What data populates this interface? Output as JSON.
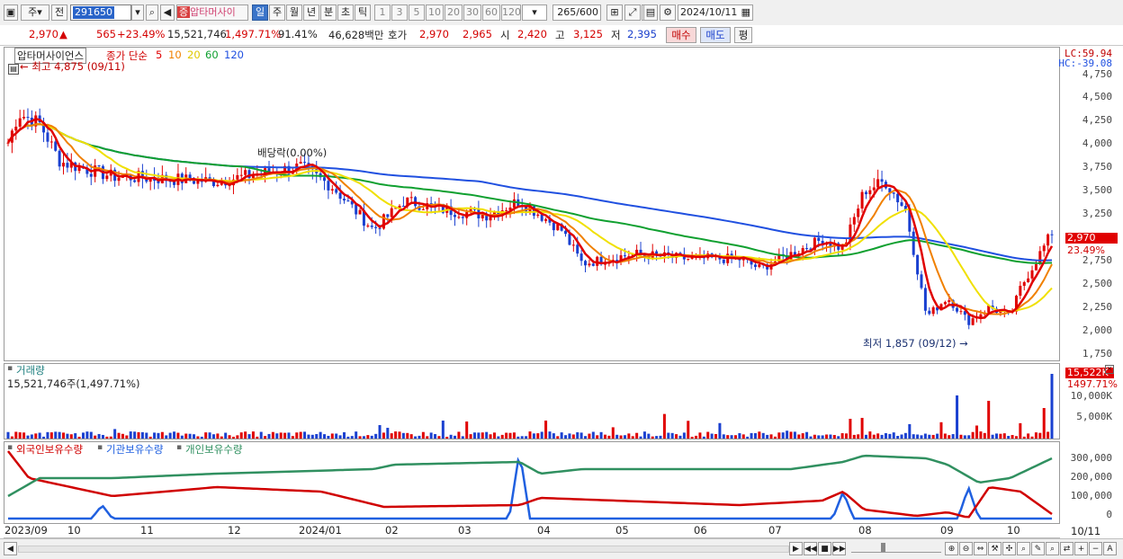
{
  "toolbar": {
    "period_unit": "주",
    "prev_label": "전",
    "stock_code": "291650",
    "stock_name": "압타머사이",
    "name_badge": "증",
    "periods": [
      "일",
      "주",
      "월",
      "년",
      "분",
      "초",
      "틱"
    ],
    "selected_period": "일",
    "intervals": [
      "1",
      "3",
      "5",
      "10",
      "20",
      "30",
      "60",
      "120"
    ],
    "count": "265",
    "count_max": "/600",
    "date": "2024/10/11"
  },
  "quote": {
    "price": "2,970",
    "change_arrow": "▲",
    "change": "565",
    "change_pct": "+23.49%",
    "volume": "15,521,746",
    "volume_ratio": "1,497.71%",
    "turnover": "91.41%",
    "amount": "46,628백만",
    "bid_label": "호가",
    "ask_price": "2,970",
    "bid_price": "2,965",
    "open_label": "시",
    "open": "2,420",
    "high_label": "고",
    "high": "3,125",
    "low_label": "저",
    "low": "2,395",
    "buy_label": "매수",
    "sell_label": "매도",
    "avg_label": "평"
  },
  "price_panel": {
    "stock_label": "압타머사이언스",
    "ma_label": "종가 단순",
    "ma_periods": [
      "5",
      "10",
      "20",
      "60",
      "120"
    ],
    "ma_colors": [
      "#e00000",
      "#f08000",
      "#f0e000",
      "#10a030",
      "#2050e0"
    ],
    "high_note": "최고 4,875 (09/11)",
    "dividend_note": "배당락(0.00%)",
    "low_note": "최저 1,857 (09/12)",
    "lc": "LC:59.94",
    "hc": "HC:-39.08",
    "last_price": "2,970",
    "last_pct": "23.49%",
    "ticks": [
      "4,750",
      "4,500",
      "4,250",
      "4,000",
      "3,750",
      "3,500",
      "3,250",
      "2,750",
      "2,500",
      "2,250",
      "2,000",
      "1,750"
    ],
    "up_color": "#e00000",
    "down_color": "#1a40d0"
  },
  "volume_panel": {
    "title": "거래량",
    "value": "15,521,746주(1,497.71%)",
    "last_value": "15,522K",
    "last_pct": "1497.71%",
    "ticks": [
      "10,000K",
      "5,000K"
    ]
  },
  "holding_panel": {
    "foreign": "외국인보유수량",
    "institution": "기관보유수량",
    "individual": "개인보유수량",
    "colors": [
      "#d00000",
      "#2060e0",
      "#309060"
    ],
    "ticks": [
      "300,000",
      "200,000",
      "100,000",
      "0"
    ]
  },
  "x_axis": {
    "labels": [
      "2023/09",
      "10",
      "11",
      "12",
      "2024/01",
      "02",
      "03",
      "04",
      "05",
      "06",
      "07",
      "08",
      "09",
      "10"
    ],
    "right_label": "10/11"
  },
  "chart_data": {
    "type": "line",
    "title": "",
    "series": [
      {
        "name": "종가 단순 120",
        "values": []
      }
    ],
    "ylim": [
      1750,
      4875
    ],
    "high": {
      "value": 4875,
      "date": "09/11"
    },
    "low": {
      "value": 1857,
      "date": "09/12"
    },
    "last": 2970
  }
}
